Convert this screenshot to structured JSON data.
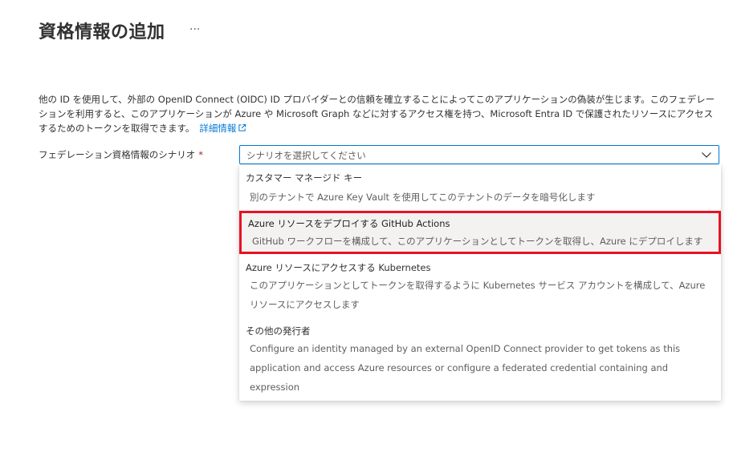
{
  "page": {
    "title": "資格情報の追加",
    "more_label": "···"
  },
  "description": {
    "text": "他の ID を使用して、外部の OpenID Connect (OIDC) ID プロバイダーとの信頼を確立することによってこのアプリケーションの偽装が生じます。このフェデレーションを利用すると、このアプリケーションが Azure や Microsoft Graph などに対するアクセス権を持つ、Microsoft Entra ID で保護されたリソースにアクセスするためのトークンを取得できます。",
    "link_label": "詳細情報"
  },
  "field": {
    "label": "フェデレーション資格情報のシナリオ",
    "required_mark": "*",
    "placeholder": "シナリオを選択してください"
  },
  "options": [
    {
      "title": "カスタマー マネージド キー",
      "description": "別のテナントで Azure Key Vault を使用してこのテナントのデータを暗号化します"
    },
    {
      "title": "Azure リソースをデプロイする GitHub Actions",
      "description": "GitHub ワークフローを構成して、このアプリケーションとしてトークンを取得し、Azure にデプロイします"
    },
    {
      "title": "Azure リソースにアクセスする Kubernetes",
      "description": "このアプリケーションとしてトークンを取得するように Kubernetes サービス アカウントを構成して、Azure リソースにアクセスします"
    },
    {
      "title": "その他の発行者",
      "description": "Configure an identity managed by an external OpenID Connect provider to get tokens as this application and access Azure resources or configure a federated credential containing and expression"
    }
  ],
  "colors": {
    "link": "#0078d4",
    "highlight_border": "#e81123",
    "required": "#a4262c"
  }
}
